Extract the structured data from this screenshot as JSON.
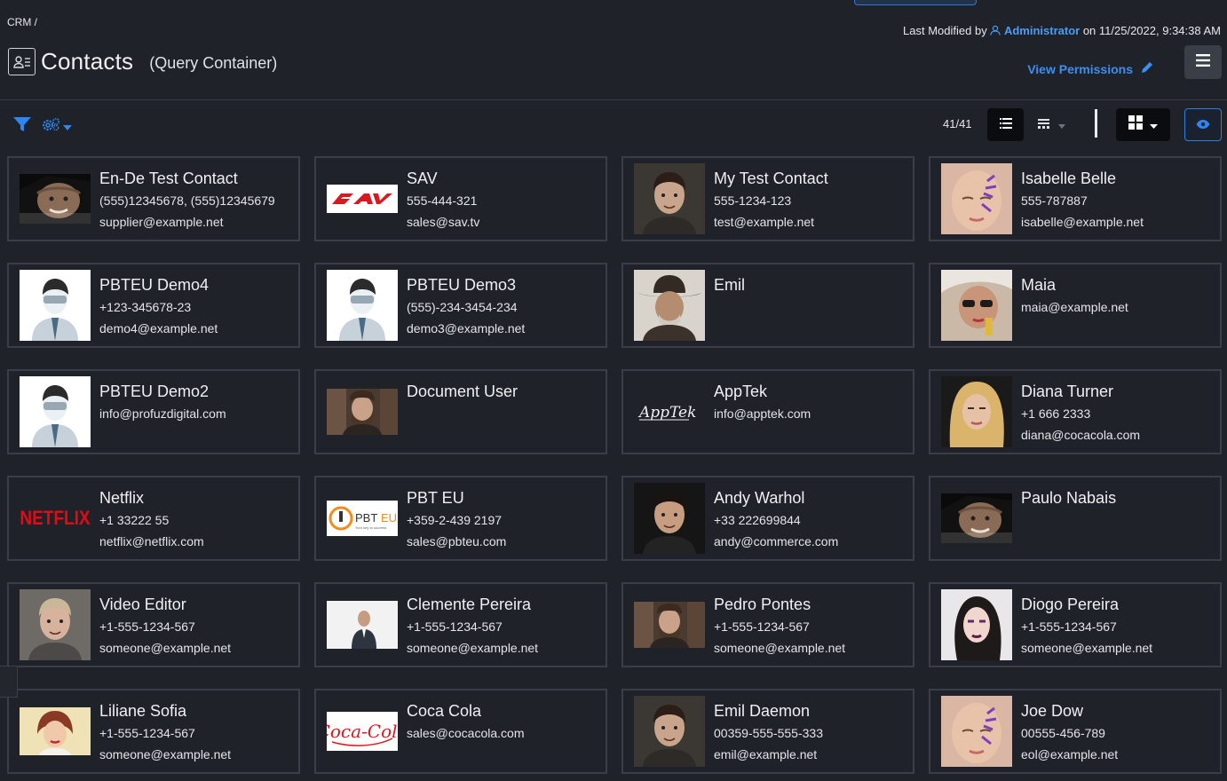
{
  "breadcrumb": "CRM /",
  "last_modified": {
    "prefix": "Last Modified by",
    "user": "Administrator",
    "suffix": "on 11/25/2022, 9:34:38 AM"
  },
  "header": {
    "title": "Contacts",
    "subtitle": "(Query Container)",
    "view_permissions": "View Permissions"
  },
  "toolbar": {
    "count": "41/41"
  },
  "colors": {
    "accent": "#3b8ff0",
    "background": "#1f2229",
    "card_border": "#3a3e46"
  },
  "contacts": [
    {
      "name": "En-De Test Contact",
      "lines": [
        "(555)12345678, (555)12345679",
        "supplier@example.net"
      ],
      "avatar": "portrait-old-man"
    },
    {
      "name": "SAV",
      "lines": [
        "555-444-321",
        "sales@sav.tv"
      ],
      "avatar": "logo-sav"
    },
    {
      "name": "My Test Contact",
      "lines": [
        "555-1234-123",
        "test@example.net"
      ],
      "avatar": "portrait-man-dark"
    },
    {
      "name": "Isabelle Belle",
      "lines": [
        "555-787887",
        "isabelle@example.net"
      ],
      "avatar": "portrait-woman-paint"
    },
    {
      "name": "PBTEU Demo4",
      "lines": [
        "+123-345678-23",
        "demo4@example.net"
      ],
      "avatar": "placeholder-person"
    },
    {
      "name": "PBTEU Demo3",
      "lines": [
        "(555)-234-3454-234",
        "demo3@example.net"
      ],
      "avatar": "placeholder-person"
    },
    {
      "name": "Emil",
      "lines": [],
      "avatar": "portrait-cowboy"
    },
    {
      "name": "Maia",
      "lines": [
        "maia@example.net"
      ],
      "avatar": "portrait-woman-glasses"
    },
    {
      "name": "PBTEU Demo2",
      "lines": [
        "info@profuzdigital.com"
      ],
      "avatar": "placeholder-person"
    },
    {
      "name": "Document User",
      "lines": [],
      "avatar": "portrait-bearded-man"
    },
    {
      "name": "AppTek",
      "lines": [
        "info@apptek.com"
      ],
      "avatar": "logo-apptek"
    },
    {
      "name": "Diana Turner",
      "lines": [
        "+1 666 2333",
        "diana@cocacola.com"
      ],
      "avatar": "portrait-blonde-woman"
    },
    {
      "name": "Netflix",
      "lines": [
        "+1 33222 55",
        "netflix@netflix.com"
      ],
      "avatar": "logo-netflix"
    },
    {
      "name": "PBT EU",
      "lines": [
        "+359-2-439 2197",
        "sales@pbteu.com"
      ],
      "avatar": "logo-pbteu"
    },
    {
      "name": "Andy Warhol",
      "lines": [
        "+33 222699844",
        "andy@commerce.com"
      ],
      "avatar": "portrait-young-man"
    },
    {
      "name": "Paulo Nabais",
      "lines": [],
      "avatar": "portrait-old-man"
    },
    {
      "name": "Video Editor",
      "lines": [
        "+1-555-1234-567",
        "someone@example.net"
      ],
      "avatar": "portrait-blond-man"
    },
    {
      "name": "Clemente Pereira",
      "lines": [
        "+1-555-1234-567",
        "someone@example.net"
      ],
      "avatar": "portrait-businessman"
    },
    {
      "name": "Pedro Pontes",
      "lines": [
        "+1-555-1234-567",
        "someone@example.net"
      ],
      "avatar": "portrait-bearded-man"
    },
    {
      "name": "Diogo Pereira",
      "lines": [
        "+1-555-1234-567",
        "someone@example.net"
      ],
      "avatar": "portrait-woman-dark"
    },
    {
      "name": "Liliane Sofia",
      "lines": [
        "+1-555-1234-567",
        "someone@example.net"
      ],
      "avatar": "portrait-woman-retro"
    },
    {
      "name": "Coca Cola",
      "lines": [
        "sales@cocacola.com"
      ],
      "avatar": "logo-cocacola"
    },
    {
      "name": "Emil Daemon",
      "lines": [
        "00359-555-555-333",
        "emil@example.net"
      ],
      "avatar": "portrait-man-dark"
    },
    {
      "name": "Joe Dow",
      "lines": [
        "00555-456-789",
        "eol@example.net"
      ],
      "avatar": "portrait-woman-paint"
    }
  ]
}
